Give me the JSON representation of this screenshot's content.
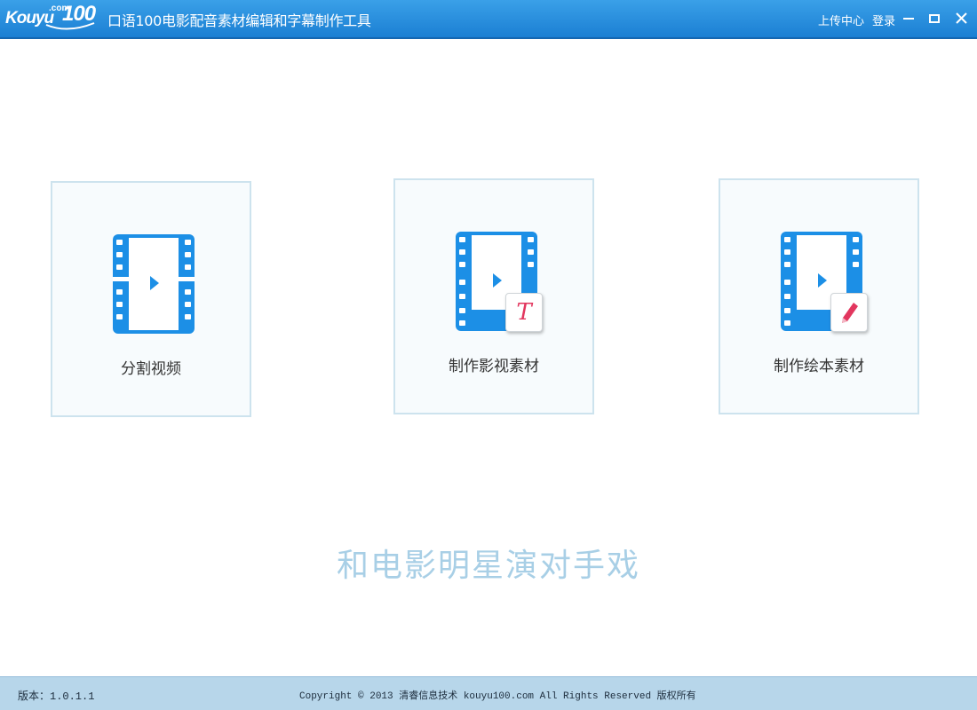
{
  "header": {
    "logo": {
      "com": ".com",
      "kouyu": "Kouyu",
      "hundred": "100"
    },
    "title": "口语100电影配音素材编辑和字幕制作工具",
    "upload_center": "上传中心",
    "login": "登录",
    "window_controls": [
      "minimize-icon",
      "maximize-icon",
      "close-icon"
    ]
  },
  "cards": [
    {
      "label": "分割视频",
      "icon": "film-play-icon"
    },
    {
      "label": "制作影视素材",
      "icon": "film-play-icon",
      "badge": "T",
      "badge_icon": "text-badge-icon"
    },
    {
      "label": "制作绘本素材",
      "icon": "film-play-icon",
      "badge_icon": "pencil-icon"
    }
  ],
  "slogan": "和电影明星演对手戏",
  "footer": {
    "version": "版本：1.0.1.1",
    "copyright": "Copyright © 2013 清睿信息技术 kouyu100.com All Rights Reserved 版权所有"
  },
  "colors": {
    "titlebar": "#2a8fde",
    "card_border": "#cde3ee",
    "film_blue": "#1c8fe6",
    "badge_red": "#e2365e",
    "slogan": "#a8cfe6",
    "footer": "#b7d6ea"
  }
}
